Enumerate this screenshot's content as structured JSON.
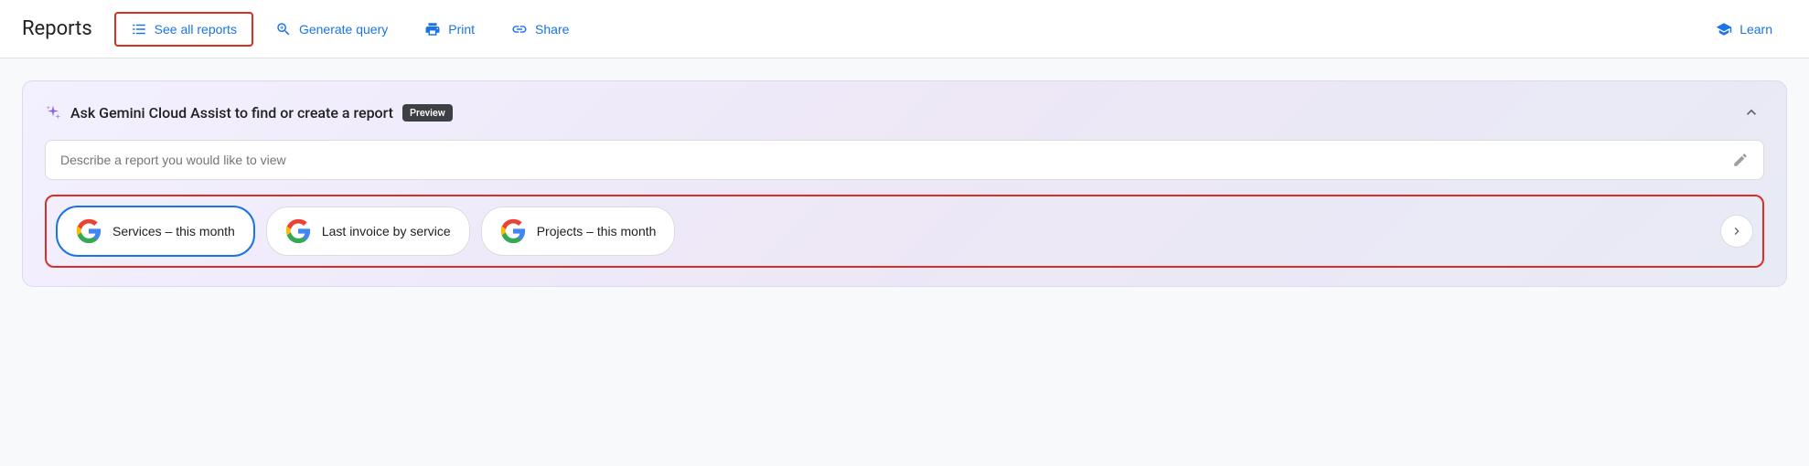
{
  "toolbar": {
    "title": "Reports",
    "buttons": [
      {
        "id": "see-all-reports",
        "label": "See all reports",
        "icon": "list",
        "highlighted": true
      },
      {
        "id": "generate-query",
        "label": "Generate query",
        "icon": "search",
        "highlighted": false
      },
      {
        "id": "print",
        "label": "Print",
        "icon": "print",
        "highlighted": false
      },
      {
        "id": "share",
        "label": "Share",
        "icon": "share",
        "highlighted": false
      }
    ],
    "learn_label": "Learn"
  },
  "gemini": {
    "title": "Ask Gemini Cloud Assist to find or create a report",
    "preview_badge": "Preview",
    "search_placeholder": "Describe a report you would like to view",
    "collapse_label": "collapse"
  },
  "quick_cards": [
    {
      "id": "services-this-month",
      "label": "Services – this month"
    },
    {
      "id": "last-invoice-by-service",
      "label": "Last invoice by service"
    },
    {
      "id": "projects-this-month",
      "label": "Projects – this month"
    }
  ]
}
